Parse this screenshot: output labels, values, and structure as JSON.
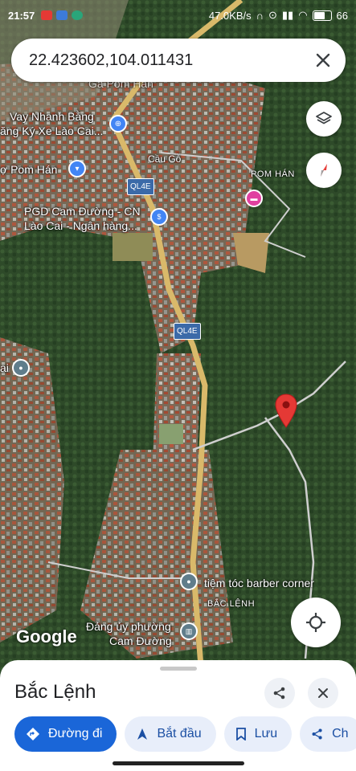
{
  "status": {
    "time": "21:57",
    "speed": "47.0KB/s",
    "battery": "66"
  },
  "search": {
    "query": "22.423602,104.011431"
  },
  "map_labels": {
    "vay": "Vay Nhanh Bằng",
    "dangky": "ăng Ký Xe Lào Cai...",
    "caugo": "Cầu Gỗ",
    "pomhan_market": "ợ Pom Hán",
    "pomhan": "POM HÁN",
    "pgd1": "PGD Cam Đường - CN",
    "pgd2": "Lào Cai - Ngân hàng...",
    "ql4e_a": "QL4E",
    "ql4e_b": "QL4E",
    "ai": "ai",
    "barber": "tiệm tóc barber corner",
    "bac_lenh_area": "BẮC LỆNH",
    "dang_uy1": "Đảng ủy phường",
    "dang_uy2": "Cam Đường",
    "top_partial": "Ga Pom Hán"
  },
  "google_logo": "Google",
  "place": {
    "title": "Bắc Lệnh"
  },
  "actions": {
    "directions": "Đường đi",
    "start": "Bắt đầu",
    "save": "Lưu",
    "share": "Ch"
  },
  "colors": {
    "primary": "#1a66d8",
    "pin": "#e53935"
  }
}
